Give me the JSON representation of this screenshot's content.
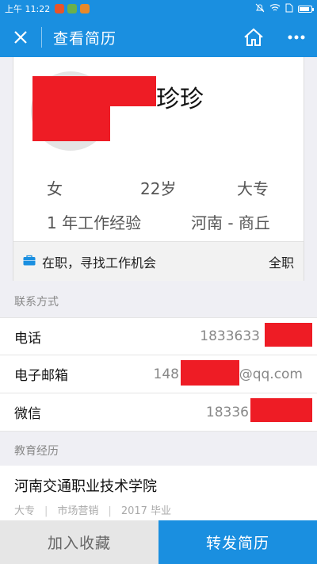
{
  "status_bar": {
    "time": "上午 11:22",
    "notification_colors": [
      "#e8542a",
      "#6ab04c",
      "#e8892a"
    ]
  },
  "header": {
    "title": "查看简历"
  },
  "profile": {
    "name": "珍珍",
    "gender": "女",
    "age": "22岁",
    "education": "大专",
    "experience": "1 年工作经验",
    "location": "河南 - 商丘",
    "job_status": "在职，寻找工作机会",
    "job_type": "全职"
  },
  "contact": {
    "section_title": "联系方式",
    "phone_label": "电话",
    "phone_value": "1833633",
    "email_label": "电子邮箱",
    "email_prefix": "148",
    "email_suffix": "@qq.com",
    "wechat_label": "微信",
    "wechat_value": "18336"
  },
  "education_section": {
    "section_title": "教育经历",
    "school": "河南交通职业技术学院",
    "degree": "大专",
    "major": "市场营销",
    "year": "2017 毕业",
    "separator": "|"
  },
  "bottom": {
    "favorite_label": "加入收藏",
    "share_label": "转发简历"
  },
  "colors": {
    "accent": "#1a8fe0",
    "redaction": "#ee1c25"
  }
}
